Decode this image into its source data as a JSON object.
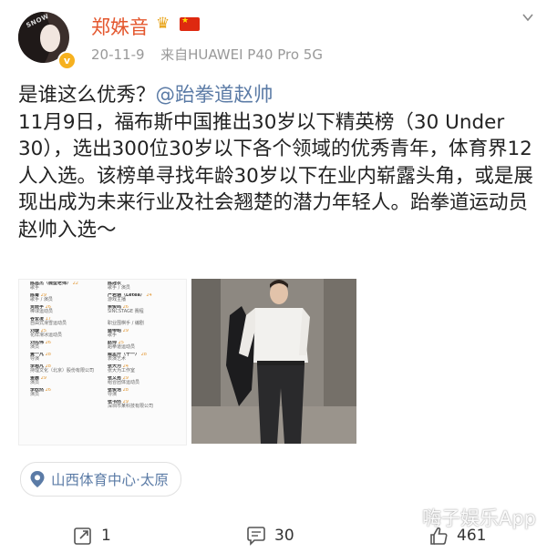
{
  "header": {
    "username": "郑姝音",
    "timestamp": "20-11-9",
    "source": "来自HUAWEI P40 Pro 5G",
    "crown_icon": "crown-icon",
    "flag_icon": "china-flag-icon",
    "avatar_cap_text": "SNOW",
    "accent_color": "#e4572e"
  },
  "post": {
    "line1_plain": "是谁这么优秀？",
    "mention": "@跆拳道赵帅",
    "body": "11月9日，福布斯中国推出30岁以下精英榜（30 Under 30），选出300位30岁以下各个领域的优秀青年，体育界12人入选。该榜单寻找年龄30岁以下在业内崭露头角，或是展现出成为未来行业及社会翘楚的潜力年轻人。跆拳道运动员赵帅入选～",
    "mention_color": "#5b7ba6"
  },
  "image_left": {
    "col1": [
      {
        "name": "陈昌杰（微型老师）",
        "age": "22",
        "desc": "歌手"
      },
      {
        "name": "陈菁",
        "age": "29",
        "desc": "歌手 / 演员"
      },
      {
        "name": "贾晓宇",
        "age": "26",
        "desc": "棒球运动员"
      },
      {
        "name": "谷爱凌",
        "age": "17",
        "desc": "自由式滑雪运动员"
      },
      {
        "name": "刘璇",
        "age": "25",
        "desc": "花样滑冰运动员"
      },
      {
        "name": "刘先伟",
        "age": "26",
        "desc": "演员"
      },
      {
        "name": "黄一凡",
        "age": "28",
        "desc": "导演"
      },
      {
        "name": "李想凡",
        "age": "28",
        "desc": "持理文化（北京）股份有限公司"
      },
      {
        "name": "金晨",
        "age": "29",
        "desc": "演员"
      },
      {
        "name": "李欣然",
        "age": "26",
        "desc": "演员"
      }
    ],
    "col2": [
      {
        "name": "陈冠农",
        "age": "",
        "desc": "歌手 / 演员"
      },
      {
        "name": "严若涵（Letea）",
        "age": "24",
        "desc": "游戏主播"
      },
      {
        "name": "余俊鸣",
        "age": "26",
        "desc": "SINCSTAGE 赛程"
      },
      {
        "name": "",
        "age": "",
        "desc": "职业围棋手 / 编剧"
      },
      {
        "name": "盛帝昭",
        "age": "29",
        "desc": "歌手"
      },
      {
        "name": "赵帅",
        "age": "25",
        "desc": "跆拳道运动员"
      },
      {
        "name": "威孟开（十一）",
        "age": "28",
        "desc": "表演艺术"
      },
      {
        "name": "张大为",
        "age": "24",
        "desc": "张大为工作室"
      },
      {
        "name": "张文秀",
        "age": "29",
        "desc": "组合团体运动员"
      },
      {
        "name": "张俊浩",
        "age": "28",
        "desc": "导演"
      },
      {
        "name": "张书然",
        "age": "29",
        "desc": "深圳市某科技有限公司"
      }
    ]
  },
  "location": {
    "label": "山西体育中心·太原",
    "icon": "location-pin-icon"
  },
  "watermark": "嗨子娱乐App",
  "actions": {
    "repost_count": "1",
    "comment_count": "30",
    "like_count": "461"
  }
}
